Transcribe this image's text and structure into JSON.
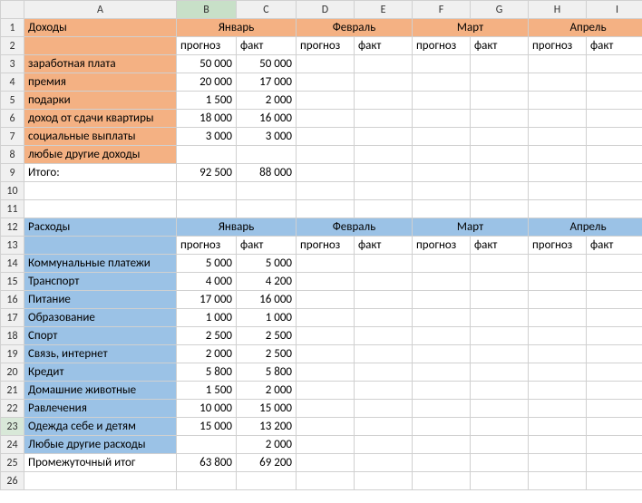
{
  "columns": [
    "A",
    "B",
    "C",
    "D",
    "E",
    "F",
    "G",
    "H",
    "I"
  ],
  "months": [
    "Январь",
    "Февраль",
    "Март",
    "Апрель"
  ],
  "headers": {
    "forecast": "прогноз",
    "fact": "факт"
  },
  "income": {
    "title": "Доходы",
    "rows": [
      {
        "label": "заработная плата",
        "forecast": "50 000",
        "fact": "50 000"
      },
      {
        "label": "премия",
        "forecast": "20 000",
        "fact": "17 000"
      },
      {
        "label": "подарки",
        "forecast": "1 500",
        "fact": "2 000"
      },
      {
        "label": "доход от сдачи квартиры",
        "forecast": "18 000",
        "fact": "16 000"
      },
      {
        "label": "социальные выплаты",
        "forecast": "3 000",
        "fact": "3 000"
      },
      {
        "label": "любые другие доходы",
        "forecast": "",
        "fact": ""
      }
    ],
    "total_label": "Итого:",
    "total_forecast": "92 500",
    "total_fact": "88 000"
  },
  "expense": {
    "title": "Расходы",
    "rows": [
      {
        "label": "Коммунальные платежи",
        "forecast": "5 000",
        "fact": "5 000"
      },
      {
        "label": "Транспорт",
        "forecast": "4 000",
        "fact": "4 200"
      },
      {
        "label": "Питание",
        "forecast": "17 000",
        "fact": "16 000"
      },
      {
        "label": "Образование",
        "forecast": "1 000",
        "fact": "1 000"
      },
      {
        "label": "Спорт",
        "forecast": "2 500",
        "fact": "2 500"
      },
      {
        "label": "Связь, интернет",
        "forecast": "2 000",
        "fact": "2 500"
      },
      {
        "label": "Кредит",
        "forecast": "5 800",
        "fact": "5 800"
      },
      {
        "label": "Домашние животные",
        "forecast": "1 500",
        "fact": "2 000"
      },
      {
        "label": "Равлечения",
        "forecast": "10 000",
        "fact": "15 000"
      },
      {
        "label": "Одежда себе и детям",
        "forecast": "15 000",
        "fact": "13 200"
      },
      {
        "label": "Любые другие расходы",
        "forecast": "",
        "fact": "2 000"
      }
    ],
    "subtotal_label": "Промежуточный итог",
    "subtotal_forecast": "63 800",
    "subtotal_fact": "69 200"
  },
  "selected_column": "B",
  "active_row": 23,
  "chart_data": [
    {
      "type": "table",
      "title": "Доходы",
      "categories": [
        "заработная плата",
        "премия",
        "подарки",
        "доход от сдачи квартиры",
        "социальные выплаты",
        "любые другие доходы",
        "Итого:"
      ],
      "series": [
        {
          "name": "Январь прогноз",
          "values": [
            50000,
            20000,
            1500,
            18000,
            3000,
            null,
            92500
          ]
        },
        {
          "name": "Январь факт",
          "values": [
            50000,
            17000,
            2000,
            16000,
            3000,
            null,
            88000
          ]
        }
      ]
    },
    {
      "type": "table",
      "title": "Расходы",
      "categories": [
        "Коммунальные платежи",
        "Транспорт",
        "Питание",
        "Образование",
        "Спорт",
        "Связь, интернет",
        "Кредит",
        "Домашние животные",
        "Равлечения",
        "Одежда себе и детям",
        "Любые другие расходы",
        "Промежуточный итог"
      ],
      "series": [
        {
          "name": "Январь прогноз",
          "values": [
            5000,
            4000,
            17000,
            1000,
            2500,
            2000,
            5800,
            1500,
            10000,
            15000,
            null,
            63800
          ]
        },
        {
          "name": "Январь факт",
          "values": [
            5000,
            4200,
            16000,
            1000,
            2500,
            2500,
            5800,
            2000,
            15000,
            13200,
            2000,
            69200
          ]
        }
      ]
    }
  ]
}
